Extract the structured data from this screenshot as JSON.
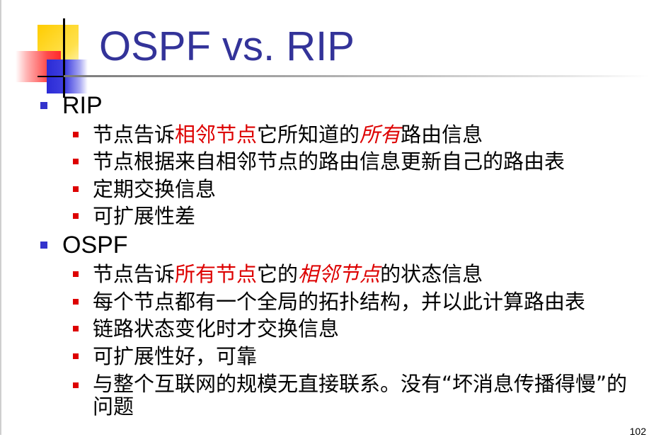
{
  "slide": {
    "title": "OSPF vs. RIP",
    "page_number": "102"
  },
  "sections": [
    {
      "heading": "RIP",
      "items": [
        {
          "parts": [
            "节点告诉",
            "相邻节点",
            "它所知道的",
            "所有",
            "路由信息"
          ]
        },
        {
          "text": "节点根据来自相邻节点的路由信息更新自己的路由表"
        },
        {
          "text": "定期交换信息"
        },
        {
          "text": "可扩展性差"
        }
      ]
    },
    {
      "heading": "OSPF",
      "items": [
        {
          "parts": [
            "节点告诉",
            "所有节点",
            "它的",
            "相邻节点",
            "的状态信息"
          ]
        },
        {
          "text": "每个节点都有一个全局的拓扑结构，并以此计算路由表"
        },
        {
          "text": "链路状态变化时才交换信息"
        },
        {
          "text": "可扩展性好，可靠"
        },
        {
          "text": "与整个互联网的规模无直接联系。没有“坏消息传播得慢”的问题"
        }
      ]
    }
  ],
  "colors": {
    "title": "#333399",
    "level1_bullet": "#3333cc",
    "level2_bullet": "#dd0000",
    "highlight": "#dd0000"
  }
}
